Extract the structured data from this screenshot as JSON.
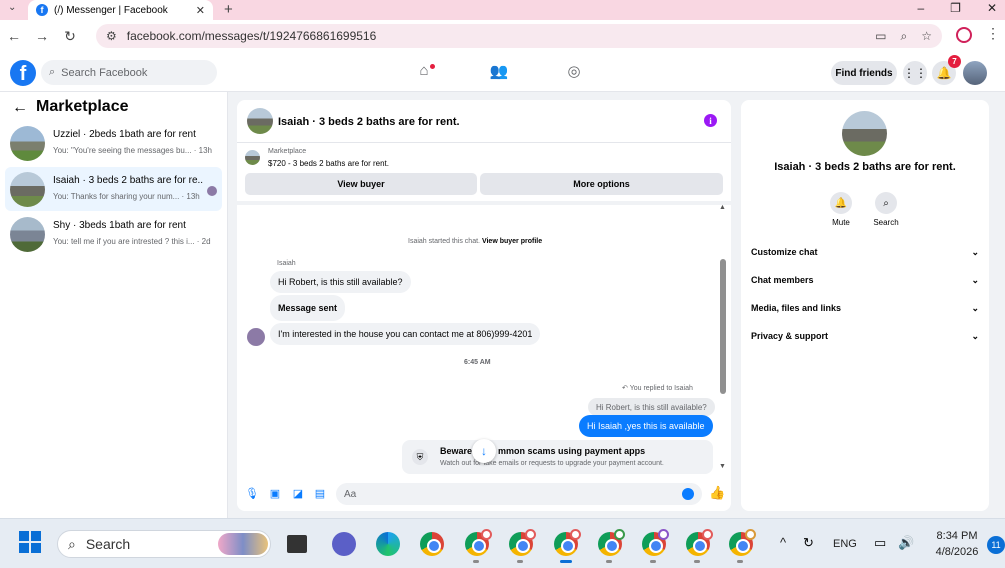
{
  "browser": {
    "tab_title": "(/) Messenger | Facebook",
    "url": "facebook.com/messages/t/1924766861699516"
  },
  "fb_header": {
    "search_placeholder": "Search Facebook",
    "find_friends": "Find friends",
    "notification_count": "7"
  },
  "sidebar": {
    "title": "Marketplace",
    "conversations": [
      {
        "name": "Uzziel · 2beds 1bath are for rent",
        "snippet": "You: \"You're seeing the messages bu...",
        "time": "13h"
      },
      {
        "name": "Isaiah · 3 beds 2 baths are for re...",
        "snippet": "You: Thanks for sharing your num...",
        "time": "13h"
      },
      {
        "name": "Shy · 3beds 1bath are for rent",
        "snippet": "You: tell me if you are intrested ? this i...",
        "time": "2d"
      }
    ]
  },
  "chat": {
    "title": "Isaiah · 3 beds 2 baths are for rent.",
    "marketplace_label": "Marketplace",
    "listing": "$720 - 3 beds 2 baths are for rent.",
    "view_buyer": "View buyer",
    "more_options": "More options",
    "started_text": "Isaiah started this chat.",
    "view_buyer_profile": "View buyer profile",
    "sender_name": "Isaiah",
    "msg1": "Hi Robert, is this still available?",
    "msg2": "Message sent",
    "msg3": "I'm interested in the house you can contact me at 806)999-4201",
    "time_sep": "6:45 AM",
    "replied_to": "You replied to Isaiah",
    "quoted": "Hi Robert, is this still available?",
    "reply": "Hi Isaiah ,yes this is available",
    "scam_title": "Beware of common scams using payment apps",
    "scam_title_visible_a": "Beware",
    "scam_title_visible_b": "mmon scams using payment apps",
    "scam_desc": "Watch out for fake emails or requests to upgrade your payment account.",
    "composer_placeholder": "Aa"
  },
  "info": {
    "title": "Isaiah · 3 beds 2 baths are for rent.",
    "mute": "Mute",
    "search": "Search",
    "rows": [
      "Customize chat",
      "Chat members",
      "Media, files and links",
      "Privacy & support"
    ]
  },
  "taskbar": {
    "search": "Search",
    "lang": "ENG",
    "time": "8:34 PM",
    "date": "4/8/2026",
    "notifications": "11"
  }
}
